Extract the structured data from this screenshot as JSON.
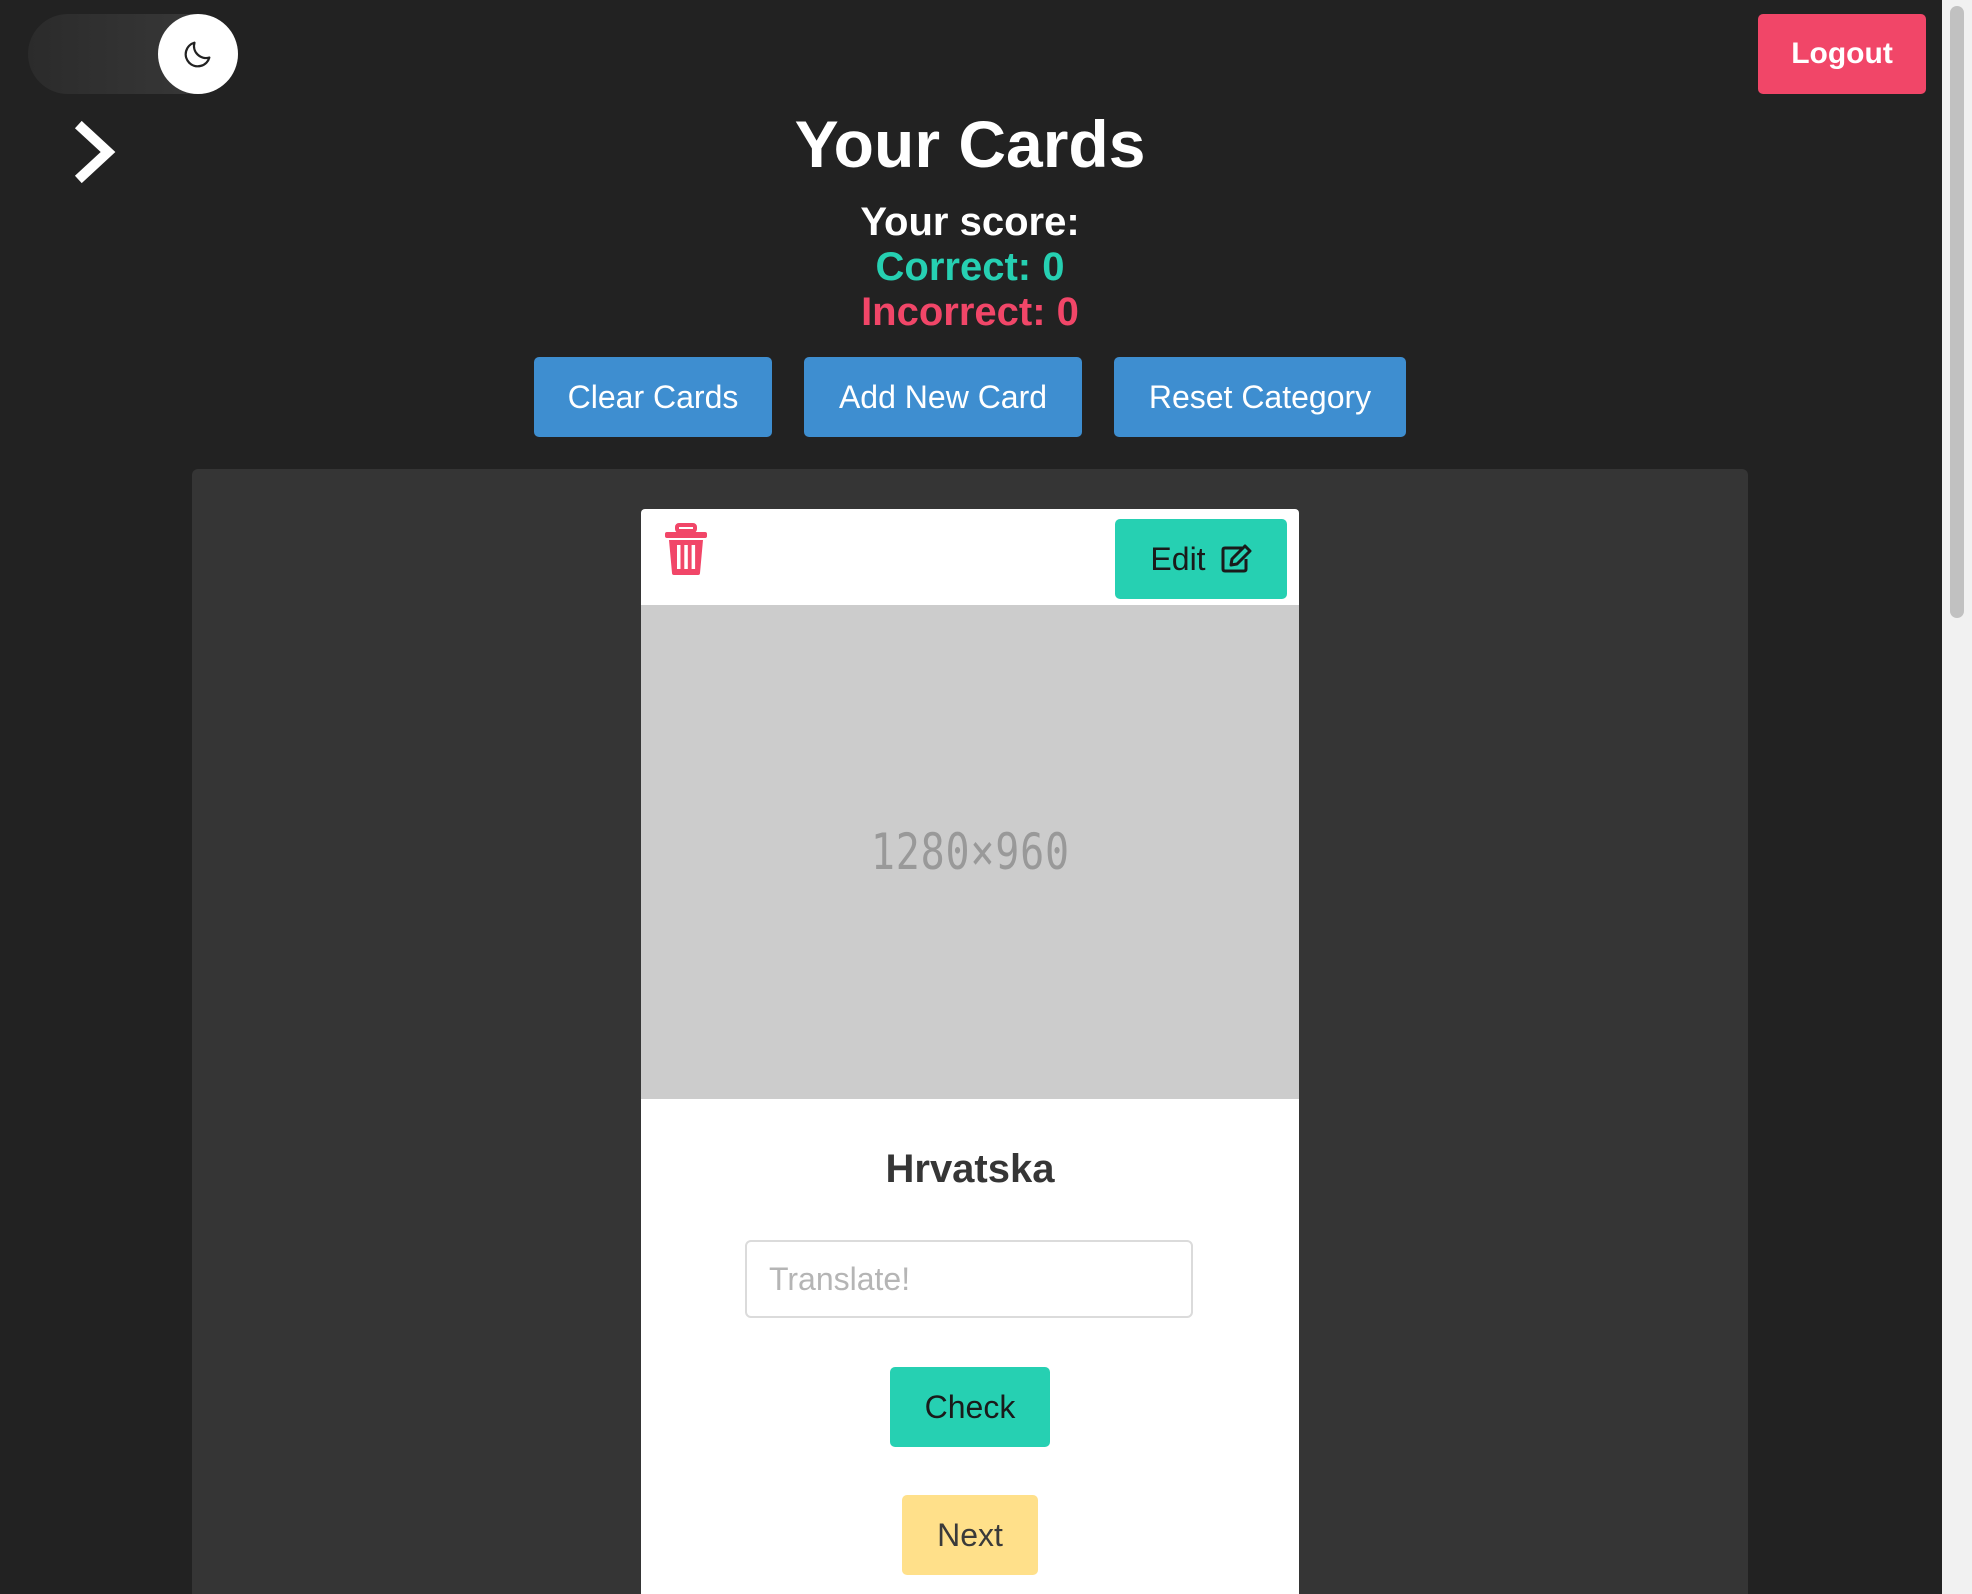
{
  "header": {
    "title": "Your Cards",
    "logout_label": "Logout",
    "theme_toggle_icon": "moon-icon",
    "sidebar_toggle_icon": "chevron-right-icon"
  },
  "score": {
    "label": "Your score:",
    "correct": "Correct: 0",
    "incorrect": "Incorrect: 0"
  },
  "actions": {
    "clear_label": "Clear Cards",
    "add_label": "Add New Card",
    "reset_label": "Reset Category"
  },
  "card": {
    "edit_label": "Edit",
    "edit_icon": "edit-icon",
    "delete_icon": "trash-icon",
    "image_placeholder": "1280×960",
    "word": "Hrvatska",
    "input_placeholder": "Translate!",
    "input_value": "",
    "check_label": "Check",
    "next_label": "Next"
  },
  "colors": {
    "background": "#222222",
    "panel": "#353535",
    "primary": "#3e8ed0",
    "success": "#26d0b2",
    "danger": "#f14668",
    "warning": "#ffe08a"
  }
}
